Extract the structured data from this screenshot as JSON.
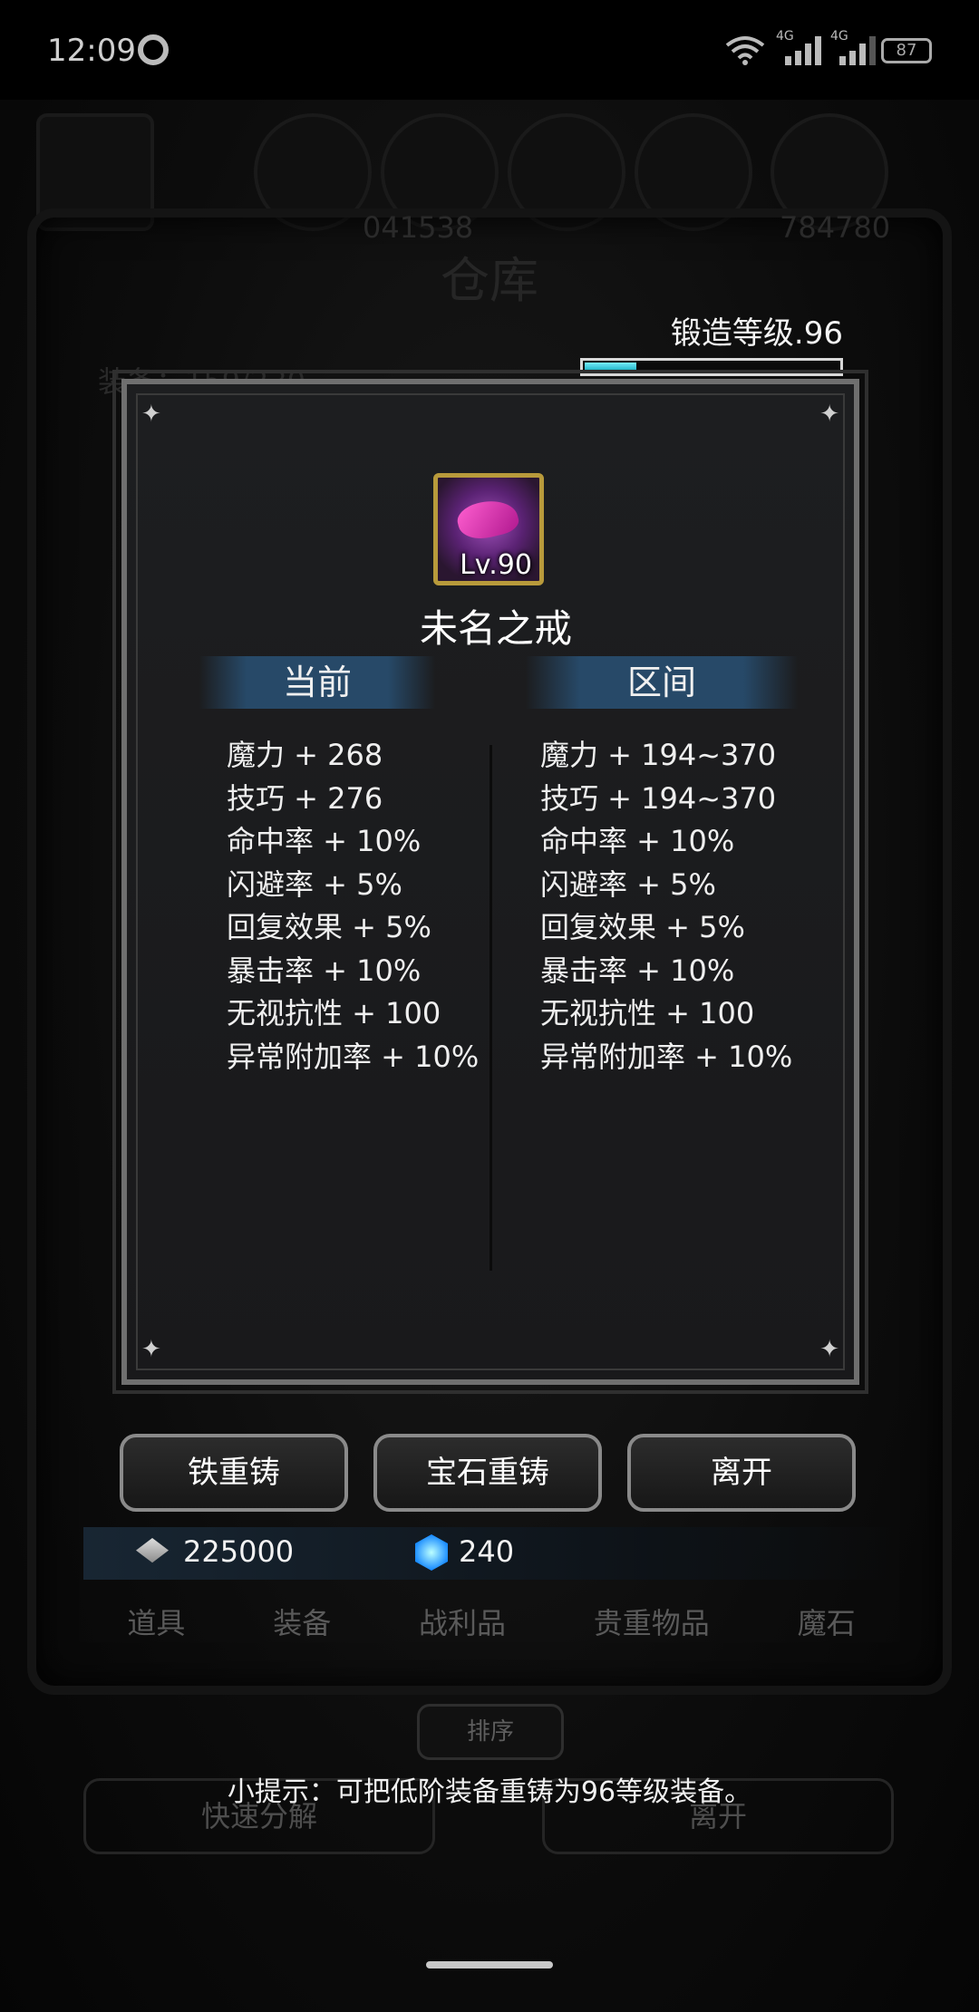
{
  "status_bar": {
    "time": "12:09",
    "signal1_label": "4G",
    "signal2_label": "4G",
    "battery": "87"
  },
  "background": {
    "title": "仓库",
    "equip_count": "装备：159/230",
    "ghost_numbers_left": "041538",
    "ghost_numbers_right": "784780",
    "forge_level": "锻造等级.96",
    "forge_progress": 0.2
  },
  "modal": {
    "item_level": "Lv.90",
    "item_name": "未名之戒",
    "current_header": "当前",
    "range_header": "区间",
    "current_stats": [
      "魔力 + 268",
      "技巧 + 276",
      "命中率 + 10%",
      "闪避率 + 5%",
      "回复效果 + 5%",
      "暴击率 + 10%",
      "无视抗性 + 100",
      "异常附加率 + 10%"
    ],
    "range_stats": [
      "魔力 + 194~370",
      "技巧 + 194~370",
      "命中率 + 10%",
      "闪避率 + 5%",
      "回复效果 + 5%",
      "暴击率 + 10%",
      "无视抗性 + 100",
      "异常附加率 + 10%"
    ]
  },
  "buttons": {
    "iron_reforge": "铁重铸",
    "gem_reforge": "宝石重铸",
    "leave": "离开"
  },
  "currency": {
    "iron": "225000",
    "gem": "240"
  },
  "tabs": [
    "道具",
    "装备",
    "战利品",
    "贵重物品",
    "魔石"
  ],
  "sort_label": "排序",
  "tip": "小提示：可把低阶装备重铸为96等级装备。",
  "bg_buttons": {
    "quick_decompose": "快速分解",
    "leave": "离开"
  },
  "colors": {
    "accent_cyan": "#22b8c8",
    "header_blue": "#284e70",
    "item_frame": "#b89a3b"
  },
  "icons": [
    "wifi-icon",
    "signal-icon",
    "battery-icon",
    "iron-currency-icon",
    "gem-currency-icon",
    "ring-item-icon"
  ]
}
